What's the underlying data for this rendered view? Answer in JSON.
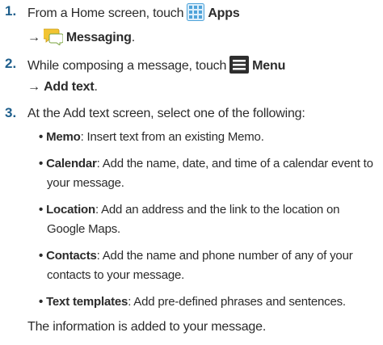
{
  "steps": [
    {
      "number": "1.",
      "line1_prefix": "From a Home screen, touch",
      "apps_label": "Apps",
      "arrow": "→",
      "messaging_label": "Messaging",
      "line2_suffix": "."
    },
    {
      "number": "2.",
      "line1_prefix": "While composing a message, touch",
      "menu_label": "Menu",
      "arrow": "→",
      "add_text_label": "Add text",
      "line2_suffix": "."
    },
    {
      "number": "3.",
      "line1": "At the Add text screen, select one of the following:",
      "options": [
        {
          "term": "Memo",
          "desc_line1": ": Insert text from an existing Memo.",
          "desc_line2": ""
        },
        {
          "term": "Calendar",
          "desc_line1": ": Add the name, date, and time of a calendar event to",
          "desc_line2": "your message."
        },
        {
          "term": "Location",
          "desc_line1": ": Add an address and the link to the location on",
          "desc_line2": "Google Maps."
        },
        {
          "term": "Contacts",
          "desc_line1": ": Add the name and phone number of any of your",
          "desc_line2": "contacts to your message."
        },
        {
          "term": "Text templates",
          "desc_line1": ": Add pre-defined phrases and sentences.",
          "desc_line2": ""
        }
      ],
      "result": "The information is added to your message."
    }
  ],
  "icons": {
    "apps": "apps-grid-icon",
    "messaging": "messaging-icon",
    "menu": "menu-icon"
  },
  "colors": {
    "step_number": "#1f5f8c",
    "apps_icon": "#4fa3d9",
    "messaging_icon": "#f2c432",
    "menu_icon": "#2e2e2e"
  }
}
